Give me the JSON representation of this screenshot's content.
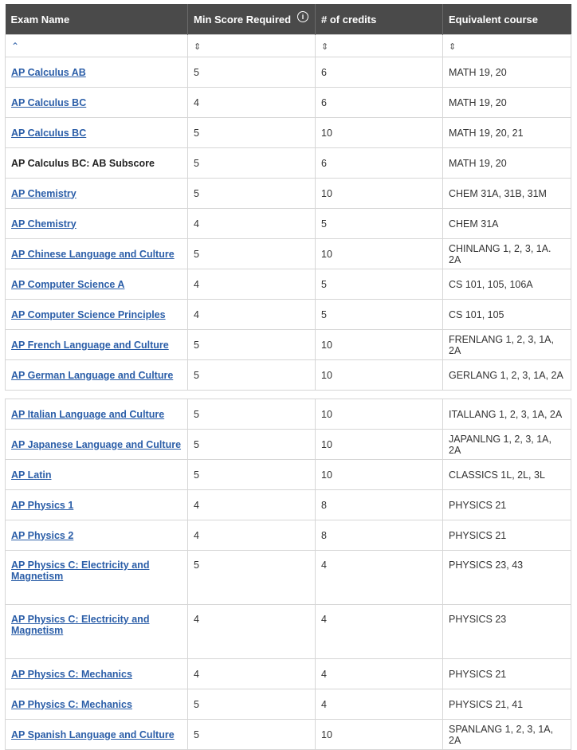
{
  "headers": [
    "Exam Name",
    "Min Score Required",
    "# of credits",
    "Equivalent course"
  ],
  "info_icon": "info-icon",
  "sort_icons": [
    "sort-ascending-icon",
    "sort-toggle-icon",
    "sort-toggle-icon",
    "sort-toggle-icon"
  ],
  "rows_top": [
    {
      "exam": "AP Calculus AB",
      "link": true,
      "score": "5",
      "credits": "6",
      "course": "MATH 19, 20"
    },
    {
      "exam": "AP Calculus BC",
      "link": true,
      "score": "4",
      "credits": "6",
      "course": "MATH 19, 20"
    },
    {
      "exam": "AP Calculus BC",
      "link": true,
      "score": "5",
      "credits": "10",
      "course": "MATH 19, 20, 21"
    },
    {
      "exam": "AP Calculus BC: AB Subscore",
      "link": false,
      "score": "5",
      "credits": "6",
      "course": "MATH 19, 20"
    },
    {
      "exam": "AP Chemistry",
      "link": true,
      "score": "5",
      "credits": "10",
      "course": "CHEM 31A, 31B, 31M"
    },
    {
      "exam": "AP Chemistry",
      "link": true,
      "score": "4",
      "credits": "5",
      "course": "CHEM 31A"
    },
    {
      "exam": "AP Chinese Language and Culture",
      "link": true,
      "score": "5",
      "credits": "10",
      "course": "CHINLANG 1, 2, 3, 1A. 2A"
    },
    {
      "exam": "AP Computer Science A",
      "link": true,
      "score": "4",
      "credits": "5",
      "course": "CS 101, 105, 106A"
    },
    {
      "exam": "AP Computer Science Principles",
      "link": true,
      "score": "4",
      "credits": "5",
      "course": "CS 101, 105"
    },
    {
      "exam": "AP French Language and Culture",
      "link": true,
      "score": "5",
      "credits": "10",
      "course": "FRENLANG 1, 2, 3, 1A, 2A"
    },
    {
      "exam": "AP German Language and Culture",
      "link": true,
      "score": "5",
      "credits": "10",
      "course": "GERLANG 1, 2, 3, 1A, 2A"
    }
  ],
  "rows_bottom": [
    {
      "exam": "AP Italian Language and Culture",
      "link": true,
      "score": "5",
      "credits": "10",
      "course": "ITALLANG 1, 2, 3, 1A, 2A"
    },
    {
      "exam": "AP Japanese Language and Culture",
      "link": true,
      "score": "5",
      "credits": "10",
      "course": "JAPANLNG 1, 2, 3, 1A, 2A"
    },
    {
      "exam": "AP Latin",
      "link": true,
      "score": "5",
      "credits": "10",
      "course": "CLASSICS 1L, 2L, 3L"
    },
    {
      "exam": "AP Physics 1",
      "link": true,
      "score": "4",
      "credits": "8",
      "course": "PHYSICS 21"
    },
    {
      "exam": "AP Physics 2",
      "link": true,
      "score": "4",
      "credits": "8",
      "course": "PHYSICS 21"
    },
    {
      "exam": "AP Physics C: Electricity and Magnetism",
      "link": true,
      "tall": true,
      "score": "5",
      "credits": "4",
      "course": "PHYSICS 23, 43"
    },
    {
      "exam": "AP Physics C: Electricity and Magnetism",
      "link": true,
      "tall": true,
      "score": "4",
      "credits": "4",
      "course": "PHYSICS 23"
    },
    {
      "exam": "AP Physics C: Mechanics",
      "link": true,
      "score": "4",
      "credits": "4",
      "course": "PHYSICS 21"
    },
    {
      "exam": "AP Physics C: Mechanics",
      "link": true,
      "score": "5",
      "credits": "4",
      "course": "PHYSICS 21, 41"
    },
    {
      "exam": "AP Spanish Language and Culture",
      "link": true,
      "score": "5",
      "credits": "10",
      "course": "SPANLANG 1, 2, 3, 1A, 2A"
    }
  ]
}
